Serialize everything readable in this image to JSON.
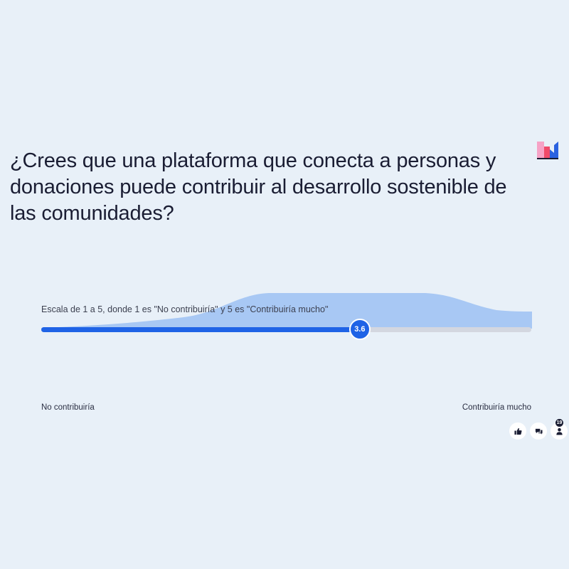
{
  "question": {
    "text": "¿Crees que una plataforma que conecta a personas y donaciones puede contribuir al desarrollo sostenible de las comunidades?"
  },
  "scale": {
    "caption": "Escala de 1 a 5, donde 1 es \"No contribuiría\" y 5 es \"Contribuiría mucho\"",
    "min": 1,
    "max": 5,
    "average": 3.6,
    "average_label": "3.6",
    "min_label": "No contribuiría",
    "max_label": "Contribuiría mucho"
  },
  "colors": {
    "background": "#e8f0f8",
    "accent": "#1f63e6",
    "distribution": "#a8c8f4",
    "track": "#d3d7e0"
  },
  "actions": [
    {
      "name": "like",
      "icon": "thumbs-up-icon"
    },
    {
      "name": "comments",
      "icon": "speech-bubbles-icon"
    },
    {
      "name": "participants",
      "icon": "person-icon",
      "count": "19"
    }
  ]
}
